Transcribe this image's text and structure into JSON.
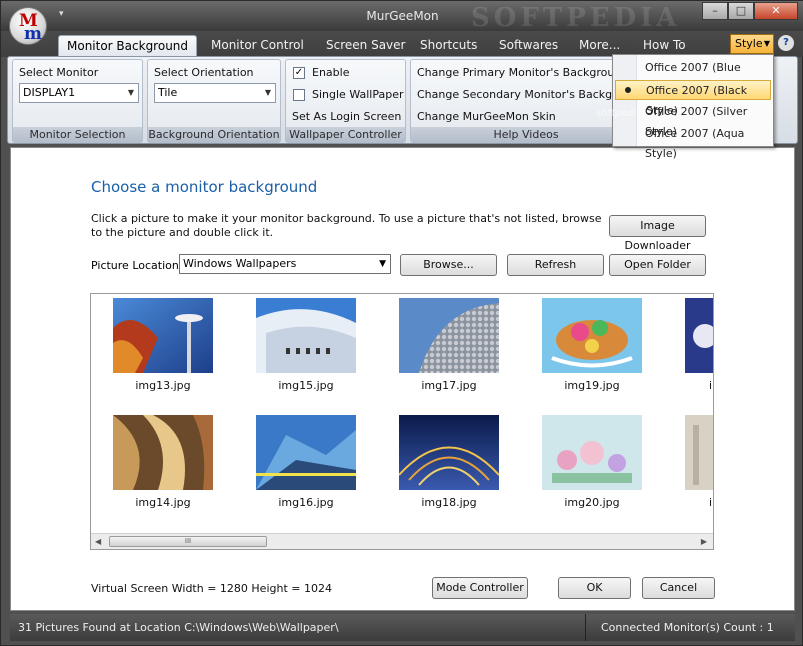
{
  "window": {
    "title": "MurGeeMon",
    "watermark": "SOFTPEDIA",
    "controls": [
      "–",
      "□",
      "✕"
    ]
  },
  "tabs": [
    {
      "label": "Monitor Background",
      "active": true
    },
    {
      "label": "Monitor Control"
    },
    {
      "label": "Screen Saver"
    },
    {
      "label": "Shortcuts"
    },
    {
      "label": "Softwares"
    },
    {
      "label": "More..."
    },
    {
      "label": "How To"
    }
  ],
  "style_button": {
    "label": "Style"
  },
  "ribbon": {
    "monitor_selection": {
      "label": "Select Monitor",
      "value": "DISPLAY1",
      "caption": "Monitor Selection"
    },
    "orientation": {
      "label": "Select Orientation",
      "value": "Tile",
      "caption": "Background Orientation"
    },
    "wallpaper": {
      "enable_label": "Enable",
      "enable_checked": true,
      "single_label": "Single WallPaper",
      "single_checked": false,
      "login_label": "Set As Login Screen",
      "caption": "Wallpaper Controller"
    },
    "help": {
      "items": [
        "Change Primary Monitor's Background",
        "Change Secondary Monitor's Backgro",
        "Change MurGeeMon Skin"
      ],
      "caption": "Help Videos"
    }
  },
  "style_menu": {
    "items": [
      {
        "label": "Office 2007 (Blue Style)",
        "selected": false
      },
      {
        "label": "Office 2007 (Black Style)",
        "selected": true
      },
      {
        "label": "Office 2007 (Silver Style)",
        "selected": false
      },
      {
        "label": "Office 2007 (Aqua Style)",
        "selected": false
      }
    ],
    "watermark": "softpedia"
  },
  "main": {
    "title": "Choose a monitor background",
    "description": "Click a picture to make it your monitor background. To use a picture that's not listed, browse to the picture and double click it.",
    "image_downloader": "Image Downloader",
    "location_label": "Picture Location:",
    "location_value": "Windows Wallpapers",
    "browse": "Browse...",
    "refresh": "Refresh",
    "open_folder": "Open Folder",
    "thumbnails": [
      {
        "file": "img13.jpg"
      },
      {
        "file": "img15.jpg"
      },
      {
        "file": "img17.jpg"
      },
      {
        "file": "img19.jpg"
      },
      {
        "file": "i"
      },
      {
        "file": "img14.jpg"
      },
      {
        "file": "img16.jpg"
      },
      {
        "file": "img18.jpg"
      },
      {
        "file": "img20.jpg"
      },
      {
        "file": "i"
      }
    ],
    "scroll_grip": "III",
    "virtual_screen": "Virtual Screen Width = 1280 Height = 1024",
    "mode_controller": "Mode Controller",
    "ok": "OK",
    "cancel": "Cancel"
  },
  "status": {
    "left": "31 Pictures Found at Location C:\\Windows\\Web\\Wallpaper\\",
    "right": "Connected Monitor(s) Count : 1"
  }
}
